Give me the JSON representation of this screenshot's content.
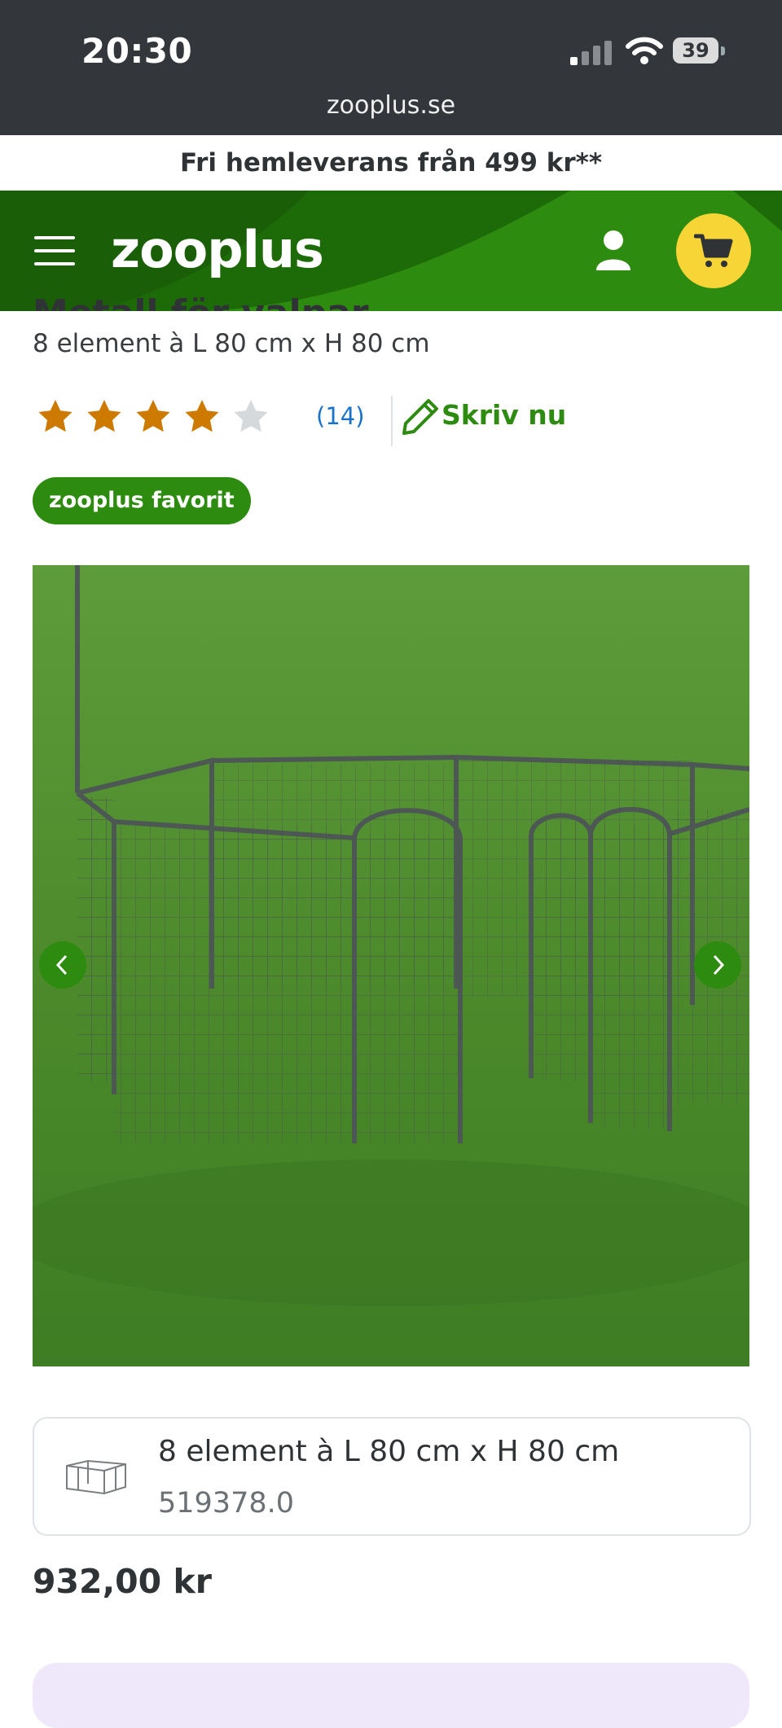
{
  "status_bar": {
    "time": "20:30",
    "battery_level": "39",
    "url": "zooplus.se"
  },
  "promo": {
    "text": "Fri hemleverans från 499 kr**"
  },
  "header": {
    "logo": "zooplus",
    "icons": [
      "menu-icon",
      "user-icon",
      "cart-icon"
    ],
    "brand_green": "#2d8b0f",
    "cart_yellow": "#f8d536"
  },
  "product": {
    "title_partial": "Metall för valpar",
    "subtitle": "8 element à L 80 cm x H 80 cm",
    "rating": {
      "stars": 4,
      "max": 5,
      "count_label": "(14)"
    },
    "write_review_label": "Skriv nu",
    "badge": "zooplus favorit",
    "variant": {
      "name": "8 element à L 80 cm x H 80 cm",
      "sku": "519378.0"
    },
    "price": "932,00 kr"
  }
}
